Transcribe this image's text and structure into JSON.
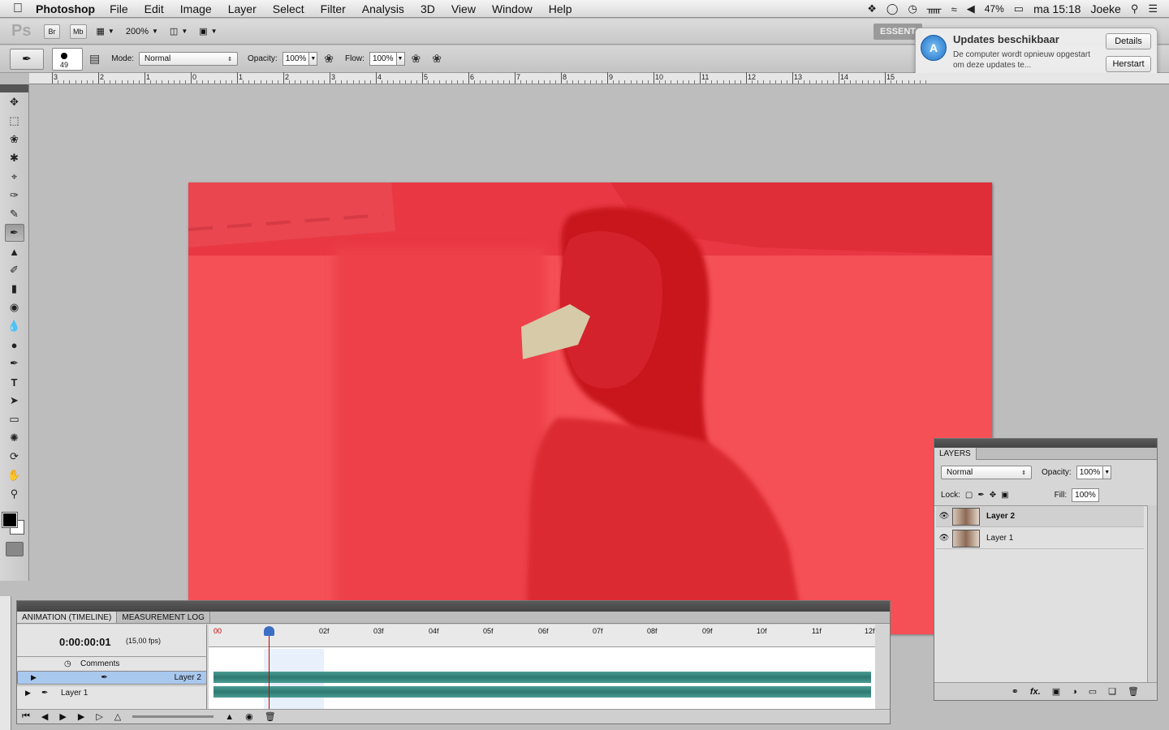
{
  "menubar": {
    "app_name": "Photoshop",
    "menus": [
      "File",
      "Edit",
      "Image",
      "Layer",
      "Select",
      "Filter",
      "Analysis",
      "3D",
      "View",
      "Window",
      "Help"
    ],
    "battery": "47%",
    "clock": "ma 15:18",
    "user": "Joeke"
  },
  "appbar": {
    "logo": "Ps",
    "bridge_btn": "Br",
    "minibridge_btn": "Mb",
    "zoom": "200%",
    "workspace": "ESSENT"
  },
  "options": {
    "brush_size": "49",
    "mode_label": "Mode:",
    "mode_value": "Normal",
    "opacity_label": "Opacity:",
    "opacity_value": "100%",
    "flow_label": "Flow:",
    "flow_value": "100%"
  },
  "notification": {
    "title": "Updates beschikbaar",
    "body": "De computer wordt opnieuw opgestart om deze updates te...",
    "details_btn": "Details",
    "restart_btn": "Herstart"
  },
  "ruler": {
    "numbers": [
      "3",
      "2",
      "1",
      "0",
      "1",
      "2",
      "3",
      "4",
      "5",
      "6",
      "7",
      "8",
      "9",
      "10",
      "11",
      "12",
      "13",
      "14",
      "15"
    ]
  },
  "timeline": {
    "tabs": [
      "ANIMATION (TIMELINE)",
      "MEASUREMENT LOG"
    ],
    "timecode": "0:00:00:01",
    "fps": "(15,00 fps)",
    "frames": [
      "00",
      "02f",
      "03f",
      "04f",
      "05f",
      "06f",
      "07f",
      "08f",
      "09f",
      "10f",
      "11f",
      "12f"
    ],
    "comments": "Comments",
    "layer2": "Layer 2",
    "layer1": "Layer 1"
  },
  "layers_panel": {
    "tab": "LAYERS",
    "blend": "Normal",
    "opacity_label": "Opacity:",
    "opacity_value": "100%",
    "lock_label": "Lock:",
    "fill_label": "Fill:",
    "fill_value": "100%",
    "layers": [
      "Layer 2",
      "Layer 1"
    ],
    "footer_fx": "fx."
  },
  "colors": {
    "canvas": "#f55056",
    "track": "#3a8a82",
    "selection": "#a9c8ee"
  }
}
